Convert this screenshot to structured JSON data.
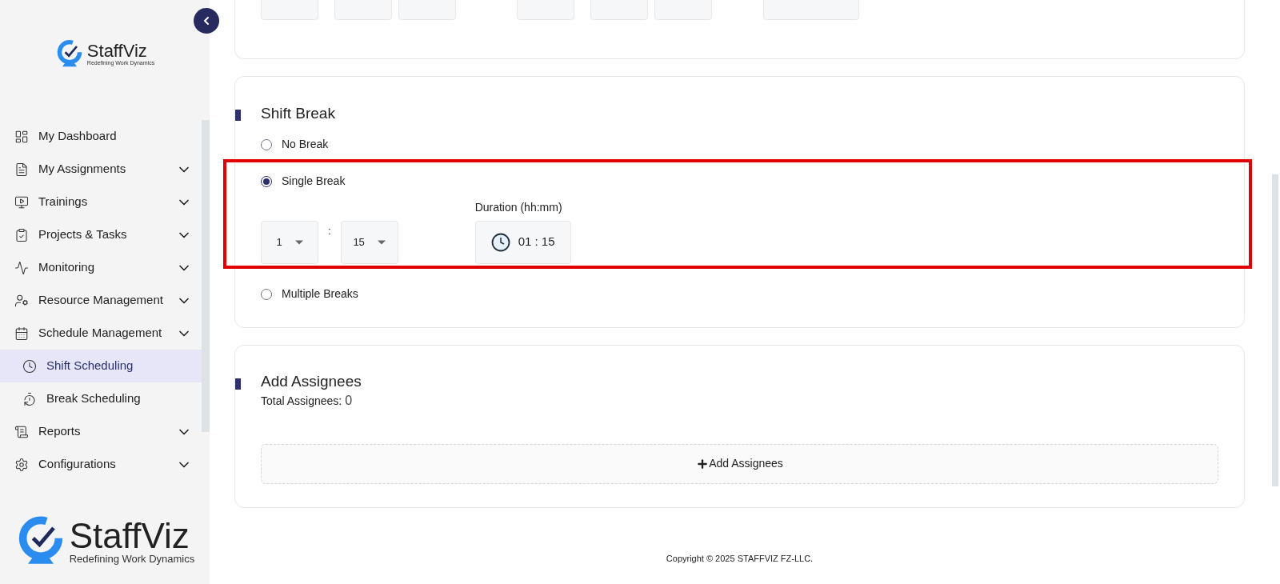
{
  "sidebar": {
    "logo": {
      "name": "StaffViz",
      "tagline": "Redefining Work Dynamics"
    },
    "items": [
      {
        "label": "My Dashboard",
        "kind": "link",
        "selected": false
      },
      {
        "label": "My Assignments",
        "kind": "group",
        "selected": false
      },
      {
        "label": "Trainings",
        "kind": "group",
        "selected": false
      },
      {
        "label": "Projects & Tasks",
        "kind": "group",
        "selected": false
      },
      {
        "label": "Monitoring",
        "kind": "group",
        "selected": false
      },
      {
        "label": "Resource Management",
        "kind": "group",
        "selected": false
      },
      {
        "label": "Schedule Management",
        "kind": "group",
        "selected": false
      },
      {
        "label": "Shift Scheduling",
        "kind": "sub",
        "selected": true
      },
      {
        "label": "Break Scheduling",
        "kind": "sub",
        "selected": false
      },
      {
        "label": "Reports",
        "kind": "group",
        "selected": false
      },
      {
        "label": "Configurations",
        "kind": "group",
        "selected": false
      }
    ],
    "footer_logo": {
      "name": "StaffViz",
      "tagline": "Redefining Work Dynamics"
    }
  },
  "shift_break": {
    "title": "Shift Break",
    "options": [
      {
        "label": "No Break",
        "selected": false
      },
      {
        "label": "Single Break",
        "selected": true,
        "hours": "1",
        "minutes": "15",
        "separator": ":",
        "duration_label": "Duration (hh:mm)",
        "duration": "01 : 15"
      },
      {
        "label": "Multiple Breaks",
        "selected": false
      }
    ]
  },
  "add_assignees": {
    "title": "Add Assignees",
    "total_label": "Total Assignees:",
    "total": "0",
    "button": "Add Assignees"
  },
  "footer": "Copyright © 2025 STAFFVIZ FZ-LLC."
}
